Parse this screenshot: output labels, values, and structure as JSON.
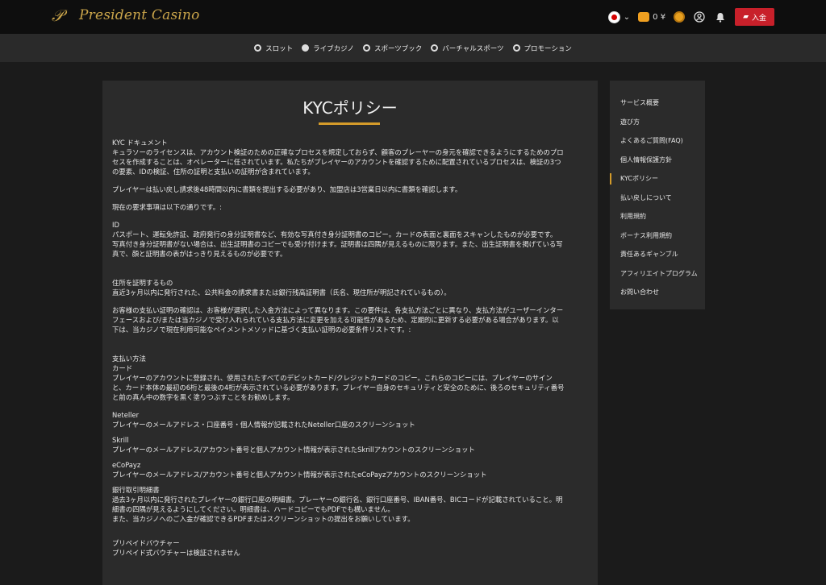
{
  "header": {
    "logo_mark": "𝒫",
    "logo_text": "President Casino",
    "wallet_amount": "0 ¥",
    "deposit_label": "入金"
  },
  "nav": {
    "items": [
      "スロット",
      "ライブカジノ",
      "スポーツブック",
      "バーチャルスポーツ",
      "プロモーション"
    ]
  },
  "page": {
    "title": "KYCポリシー",
    "intro_heading": "KYC ドキュメント",
    "intro_lines": [
      "キュラソーのライセンスは、アカウント検証のための正確なプロセスを規定しておらず、顧客のプレーヤーの身元を確認できるようにするためのプロ",
      "セスを作成することは、オペレーターに任されています。私たちがプレイヤーのアカウントを確認するために配置されているプロセスは、検証の3つ",
      "の要素、IDの検証、住所の証明と支払いの証明が含まれています。"
    ],
    "p_withdraw": "プレイヤーは払い戻し請求後48時間以内に書類を提出する必要があり、加盟店は3営業日以内に書類を確認します。",
    "p_current": "現在の要求事項は以下の通りです。:",
    "id_heading": "ID",
    "id_lines": [
      "パスポート、運転免許証、政府発行の身分証明書など、有効な写真付き身分証明書のコピー。カードの表面と裏面をスキャンしたものが必要です。",
      "写真付き身分証明書がない場合は、出生証明書のコピーでも受け付けます。証明書は四隅が見えるものに限ります。また、出生証明書を掲げている写",
      "真で、顔と証明書の表がはっきり見えるものが必要です。"
    ],
    "address_heading": "住所を証明するもの",
    "address_line": "直近3ヶ月以内に発行された、公共料金の請求書または銀行残高証明書（氏名、現住所が明記されているもの）。",
    "payment_lines": [
      "お客様の支払い証明の確認は、お客様が選択した入金方法によって異なります。この要件は、各支払方法ごとに異なり、支払方法がユーザーインター",
      "フェースおよび/または当カジノで受け入れられている支払方法に変更を加える可能性があるため、定期的に更新する必要がある場合があります。以",
      "下は、当カジノで現在利用可能なペイメントメソッドに基づく支払い証明の必要条件リストです。:"
    ],
    "methods_heading": "支払い方法",
    "card_heading": "カード",
    "card_lines": [
      "プレイヤーのアカウントに登録され、使用されたすべてのデビットカード/クレジットカードのコピー。これらのコピーには、プレイヤーのサイン",
      "と、カード本体の最初の6桁と最後の4桁が表示されている必要があります。プレイヤー自身のセキュリティと安全のために、後ろのセキュリティ番号",
      "と前の真ん中の数字を黒く塗りつぶすことをお勧めします。"
    ],
    "neteller_heading": "Neteller",
    "neteller_line": "プレイヤーのメールアドレス・口座番号・個人情報が記載されたNeteller口座のスクリーンショット",
    "skrill_heading": "Skrill",
    "skrill_line": "プレイヤーのメールアドレス/アカウント番号と個人アカウント情報が表示されたSkrillアカウントのスクリーンショット",
    "ecopayz_heading": "eCoPayz",
    "ecopayz_line": "プレイヤーのメールアドレス/アカウント番号と個人アカウント情報が表示されたeCoPayzアカウントのスクリーンショット",
    "bank_heading": "銀行取引明細書",
    "bank_lines": [
      "過去3ヶ月以内に発行されたプレイヤーの銀行口座の明細書。プレーヤーの銀行名、銀行口座番号、IBAN番号、BICコードが記載されていること。明",
      "細書の四隅が見えるようにしてください。明細書は、ハードコピーでもPDFでも構いません。",
      "また、当カジノへのご入金が確認できるPDFまたはスクリーンショットの提出をお願いしています。"
    ],
    "voucher_heading": "プリペイドバウチャー",
    "voucher_line": "プリペイド式バウチャーは検証されません"
  },
  "sidebar": {
    "items": [
      "サービス概要",
      "遊び方",
      "よくあるご質問(FAQ)",
      "個人情報保護方針",
      "KYCポリシー",
      "払い戻しについて",
      "利用規約",
      "ボーナス利用規約",
      "責任あるギャンブル",
      "アフィリエイトプログラム",
      "お問い合わせ"
    ],
    "active_index": 4
  },
  "colors": {
    "accent": "#d49b2a",
    "deposit": "#c8202a",
    "logo": "#c9a44a"
  }
}
